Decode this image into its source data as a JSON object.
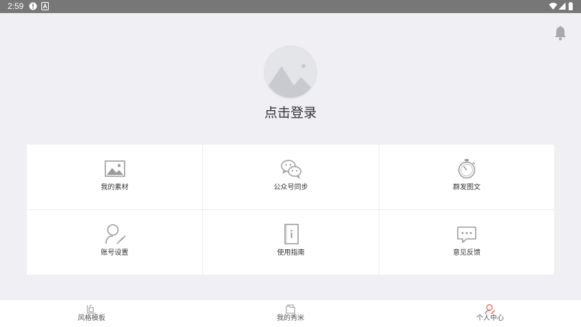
{
  "status_bar": {
    "time": "2:59"
  },
  "profile": {
    "login_label": "点击登录"
  },
  "grid": {
    "items": [
      {
        "label": "我的素材",
        "icon": "image-icon"
      },
      {
        "label": "公众号同步",
        "icon": "wechat-icon"
      },
      {
        "label": "群发图文",
        "icon": "stopwatch-icon"
      },
      {
        "label": "账号设置",
        "icon": "user-edit-icon"
      },
      {
        "label": "使用指南",
        "icon": "info-book-icon"
      },
      {
        "label": "意见反馈",
        "icon": "chat-bubble-icon"
      }
    ]
  },
  "tabbar": {
    "items": [
      {
        "label": "风格模板",
        "icon": "template-icon"
      },
      {
        "label": "我的秀米",
        "icon": "folder-icon"
      },
      {
        "label": "个人中心",
        "icon": "user-icon",
        "active": true
      }
    ]
  },
  "colors": {
    "status_bar": "#777777",
    "background": "#efeff4",
    "accent": "#e05a4f"
  }
}
